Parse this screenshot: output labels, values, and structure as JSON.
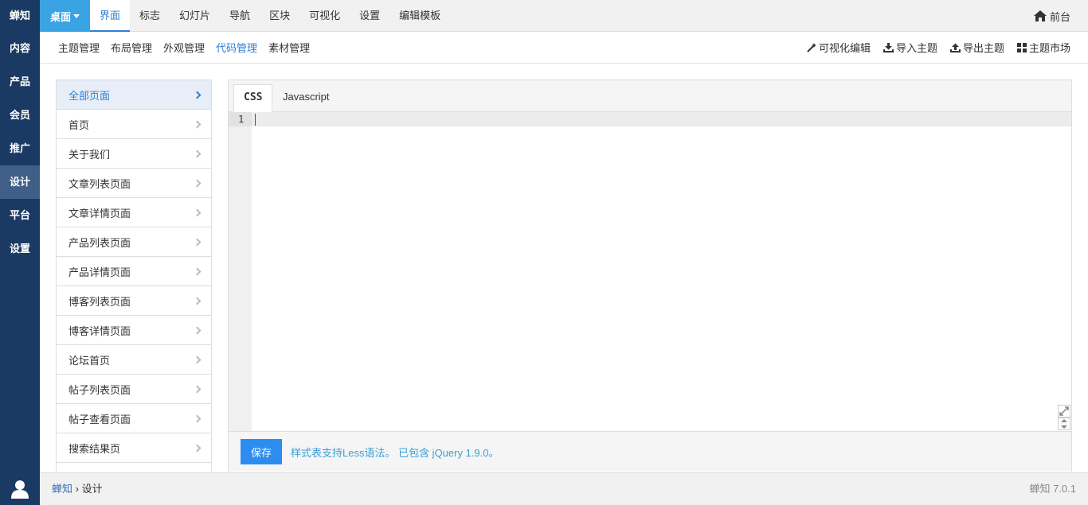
{
  "sidebar": {
    "brand": "蝉知",
    "items": [
      {
        "label": "内容",
        "active": false
      },
      {
        "label": "产品",
        "active": false
      },
      {
        "label": "会员",
        "active": false
      },
      {
        "label": "推广",
        "active": false
      },
      {
        "label": "设计",
        "active": true
      },
      {
        "label": "平台",
        "active": false
      },
      {
        "label": "设置",
        "active": false
      }
    ]
  },
  "topbar": {
    "desk_label": "桌面",
    "tabs": [
      "界面",
      "标志",
      "幻灯片",
      "导航",
      "区块",
      "可视化",
      "设置",
      "编辑模板"
    ],
    "active_tab": "界面",
    "front_label": "前台"
  },
  "subnav": {
    "items": [
      "主题管理",
      "布局管理",
      "外观管理",
      "代码管理",
      "素材管理"
    ],
    "active": "代码管理",
    "actions": {
      "visual_edit": "可视化编辑",
      "import_theme": "导入主题",
      "export_theme": "导出主题",
      "theme_market": "主题市场"
    }
  },
  "pages": [
    "全部页面",
    "首页",
    "关于我们",
    "文章列表页面",
    "文章详情页面",
    "产品列表页面",
    "产品详情页面",
    "博客列表页面",
    "博客详情页面",
    "论坛首页",
    "帖子列表页面",
    "帖子查看页面",
    "搜索结果页"
  ],
  "active_page": "全部页面",
  "editor": {
    "tabs": {
      "css": "CSS",
      "js": "Javascript"
    },
    "active_tab": "CSS",
    "line_number": "1",
    "save_label": "保存",
    "hint": "样式表支持Less语法。 已包含 jQuery 1.9.0。"
  },
  "footer": {
    "crumb_root": "蝉知",
    "crumb_sep": "›",
    "crumb_current": "设计",
    "version": "蝉知 7.0.1"
  },
  "colors": {
    "sidebar_bg": "#1a3a63",
    "sidebar_active": "#3f5f86",
    "accent": "#2d7fd3",
    "desk_button": "#3aa3e3",
    "save_button": "#2d8cf0"
  }
}
